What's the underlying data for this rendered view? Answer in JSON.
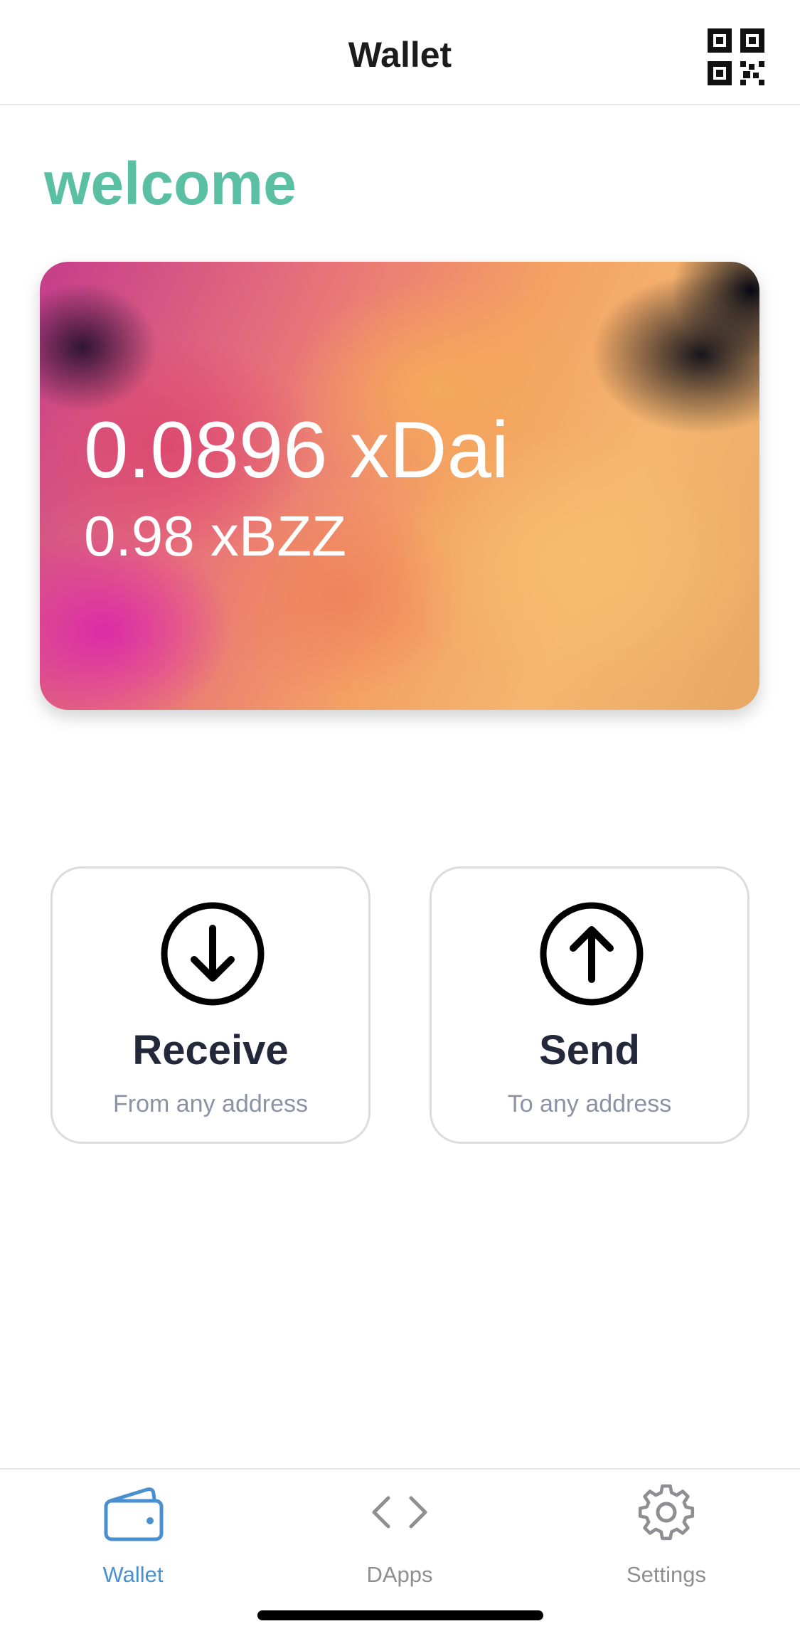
{
  "header": {
    "title": "Wallet",
    "qr_icon": "qr-code-icon"
  },
  "greeting": "welcome",
  "balance": {
    "primary": "0.0896 xDai",
    "secondary": "0.98 xBZZ"
  },
  "actions": [
    {
      "title": "Receive",
      "subtitle": "From any address",
      "icon": "arrow-down-circle-icon"
    },
    {
      "title": "Send",
      "subtitle": "To any address",
      "icon": "arrow-up-circle-icon"
    }
  ],
  "tabbar": {
    "active": "Wallet",
    "items": [
      {
        "label": "Wallet",
        "icon": "wallet-icon"
      },
      {
        "label": "DApps",
        "icon": "code-brackets-icon"
      },
      {
        "label": "Settings",
        "icon": "gear-icon"
      }
    ]
  },
  "colors": {
    "accent_green": "#5bbfa4",
    "active_tab": "#4a8fd0",
    "inactive_tab": "#8e8e93",
    "action_title": "#24283b",
    "action_subtitle": "#8a93a6"
  }
}
